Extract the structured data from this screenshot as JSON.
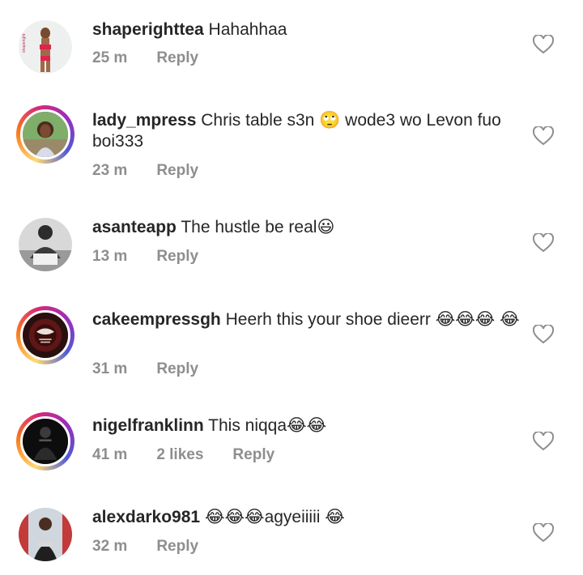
{
  "comments": [
    {
      "username": "shaperighttea",
      "text": "Hahahhaa",
      "time": "25 m",
      "likes": "",
      "reply": "Reply",
      "avatar": "woman-red-bikini"
    },
    {
      "username": "lady_mpress",
      "text": "Chris table s3n 🙄 wode3 wo Levon fuo boi333",
      "time": "23 m",
      "likes": "",
      "reply": "Reply",
      "avatar": "woman-outdoor"
    },
    {
      "username": "asanteapp",
      "text": "The hustle be real😃",
      "time": "13 m",
      "likes": "",
      "reply": "Reply",
      "avatar": "man-bw"
    },
    {
      "username": "cakeempressgh",
      "text": "Heerh this your shoe dieerr 😂😂😂 😂",
      "time": "31 m",
      "likes": "",
      "reply": "Reply",
      "avatar": "cake-logo"
    },
    {
      "username": "nigelfranklinn",
      "text": "This niqqa😂😂",
      "time": "41 m",
      "likes": "2 likes",
      "reply": "Reply",
      "avatar": "man-dark"
    },
    {
      "username": "alexdarko981",
      "text": "😂😂😂agyeiiiii 😂",
      "time": "32 m",
      "likes": "",
      "reply": "Reply",
      "avatar": "man-ring"
    }
  ],
  "icons": {
    "like": "heart-outline-icon"
  }
}
